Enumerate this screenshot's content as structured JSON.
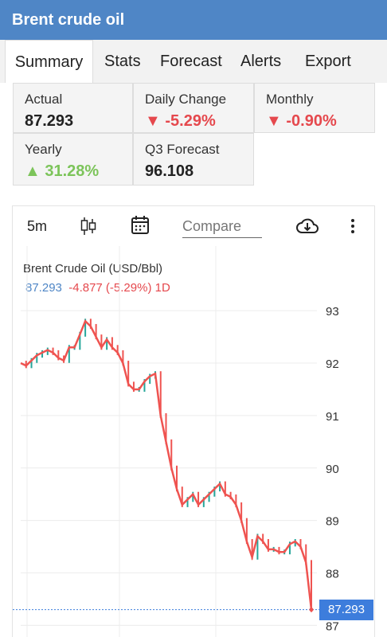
{
  "app": {
    "title": "Brent crude oil"
  },
  "tabs": [
    {
      "label": "Summary",
      "active": true
    },
    {
      "label": "Stats"
    },
    {
      "label": "Forecast"
    },
    {
      "label": "Alerts"
    },
    {
      "label": "Export"
    }
  ],
  "stats": {
    "actual": {
      "label": "Actual",
      "value": "87.293"
    },
    "daily_change": {
      "label": "Daily Change",
      "value": "-5.29%",
      "direction": "down"
    },
    "monthly": {
      "label": "Monthly",
      "value": "-0.90%",
      "direction": "down"
    },
    "yearly": {
      "label": "Yearly",
      "value": "31.28%",
      "direction": "up"
    },
    "q3_forecast": {
      "label": "Q3 Forecast",
      "value": "96.108"
    }
  },
  "chart_toolbar": {
    "interval": "5m",
    "compare_placeholder": "Compare",
    "icons": [
      "candlestick-icon",
      "calendar-icon",
      "cloud-download-icon",
      "more-vert-icon"
    ]
  },
  "chart_legend": {
    "title": "Brent Crude Oil (USD/Bbl)",
    "price": "87.293",
    "change": "-4.877 (-5.29%) 1D"
  },
  "colors": {
    "up": "#26a69a",
    "down": "#ef5350",
    "accent": "#4f86c6",
    "price_tag": "#3d7ddc"
  },
  "chart_data": {
    "type": "line",
    "title": "Brent Crude Oil (USD/Bbl)",
    "xlabel": "",
    "ylabel": "",
    "ylim": [
      86.9,
      93.2
    ],
    "y_ticks": [
      93,
      92,
      91,
      90,
      89,
      88,
      87
    ],
    "grid": true,
    "last_price_label": "87.293",
    "series": [
      {
        "values": [
          92.0,
          91.95,
          92.05,
          92.15,
          92.2,
          92.25,
          92.2,
          92.1,
          92.05,
          92.3,
          92.3,
          92.55,
          92.8,
          92.7,
          92.5,
          92.3,
          92.45,
          92.3,
          92.2,
          92.0,
          91.6,
          91.5,
          91.5,
          91.65,
          91.75,
          91.8,
          91.0,
          90.5,
          90.0,
          89.6,
          89.3,
          89.4,
          89.5,
          89.3,
          89.4,
          89.5,
          89.6,
          89.7,
          89.5,
          89.45,
          89.3,
          89.0,
          88.6,
          88.3,
          88.7,
          88.6,
          88.45,
          88.45,
          88.4,
          88.4,
          88.55,
          88.6,
          88.5,
          88.2,
          87.3
        ]
      }
    ]
  }
}
